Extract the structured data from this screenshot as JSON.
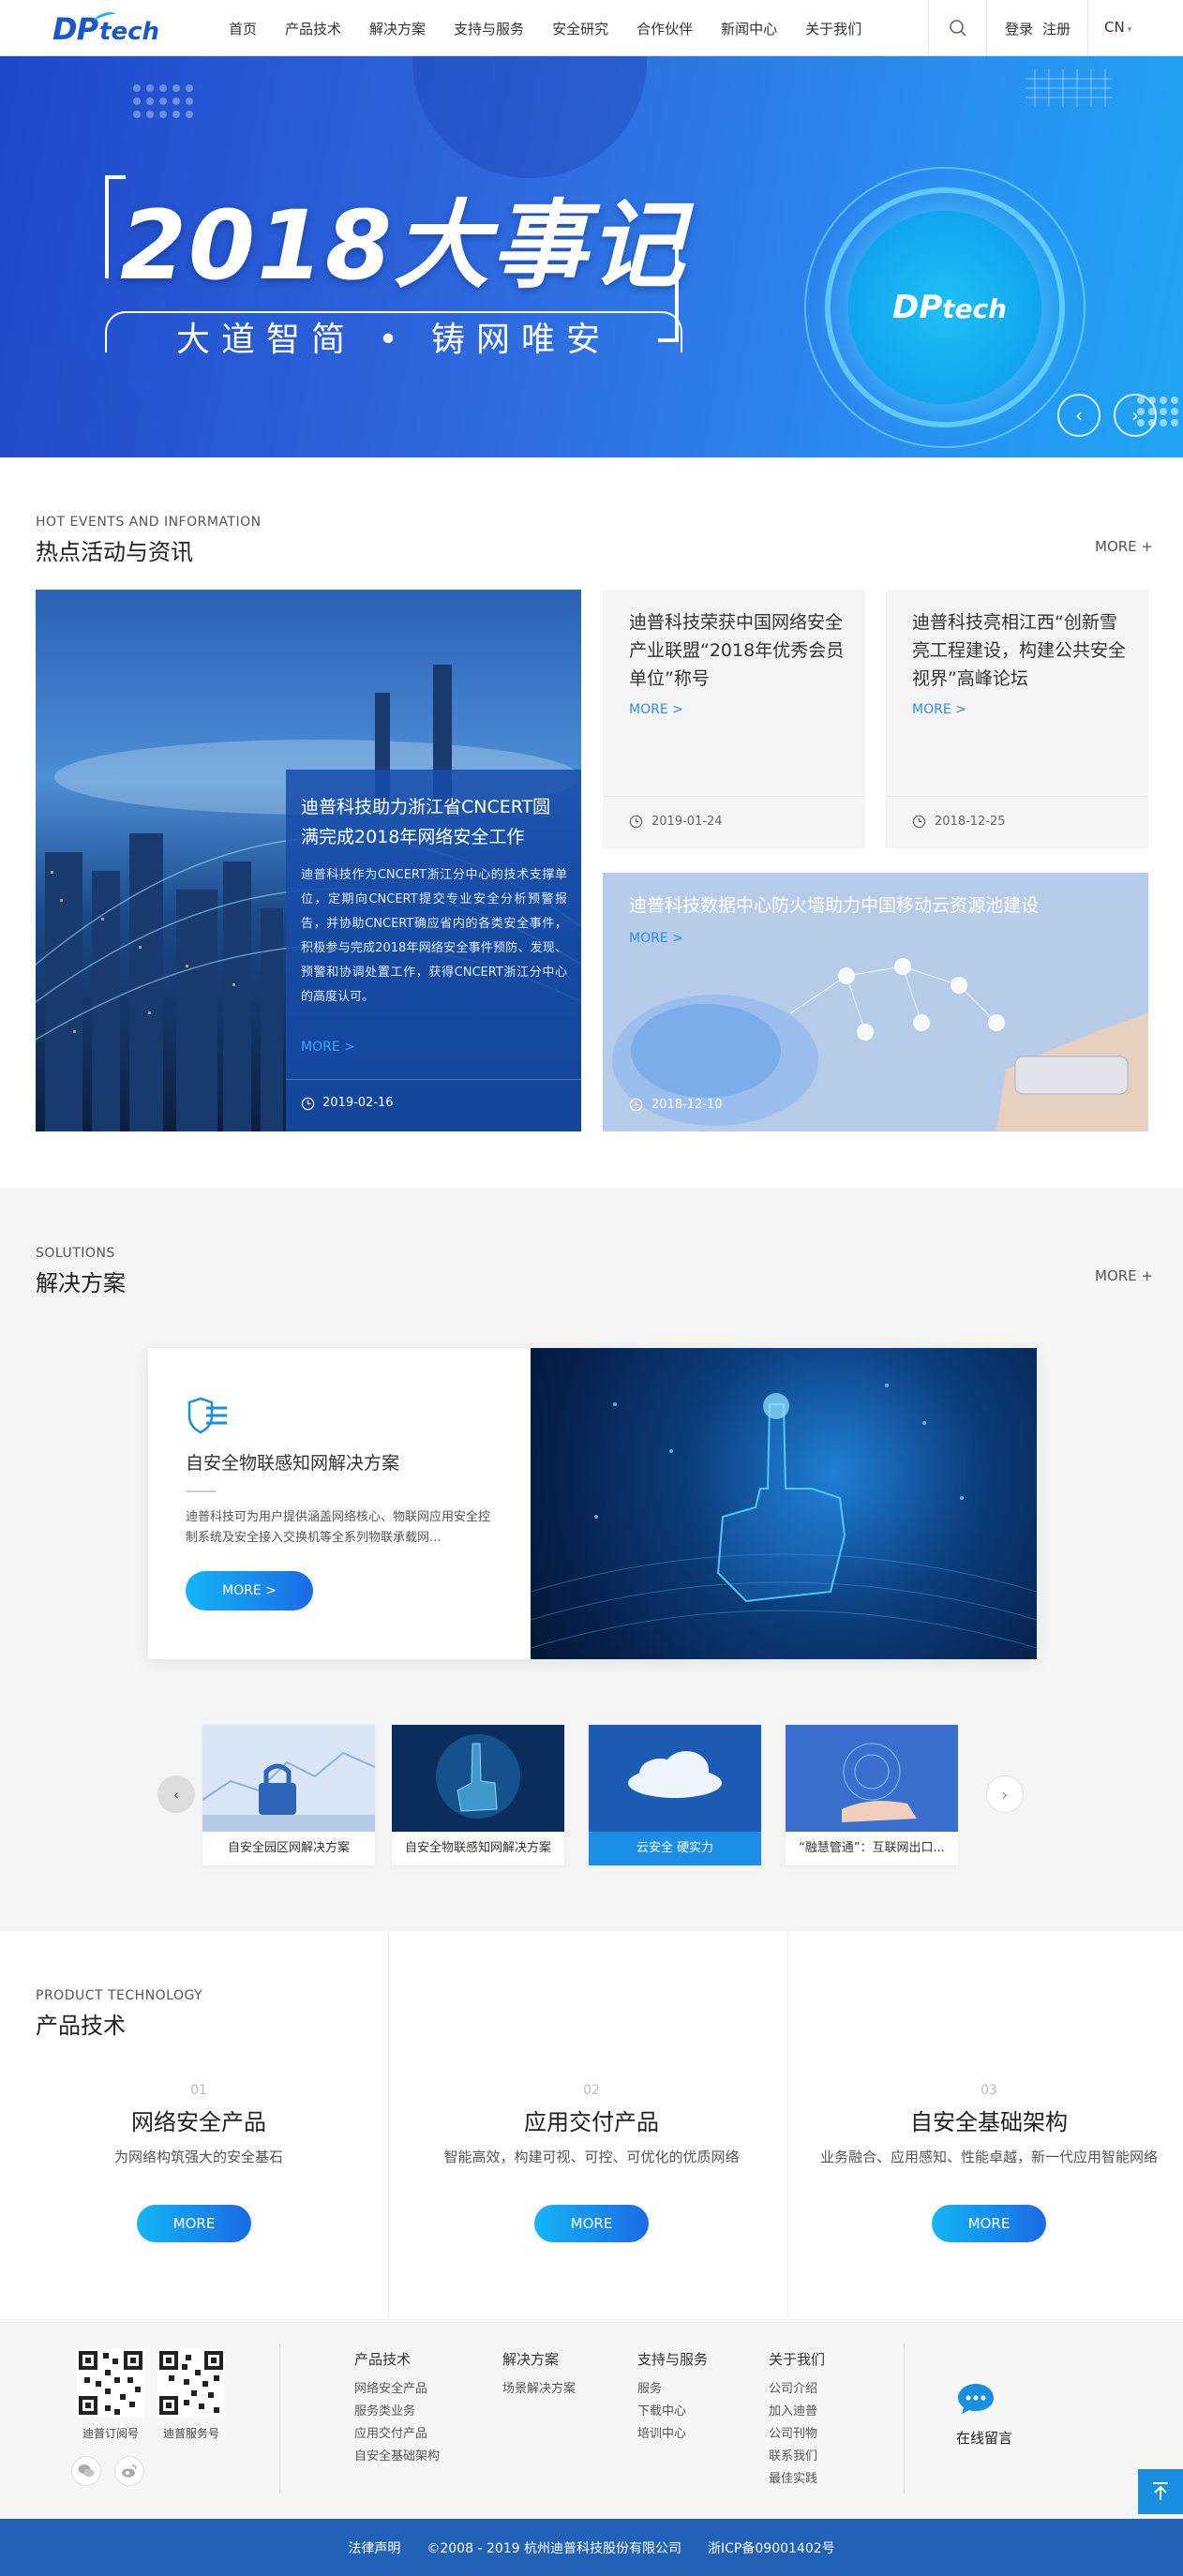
{
  "header": {
    "logo_main": "DP",
    "logo_sub": "tech",
    "nav": [
      "首页",
      "产品技术",
      "解决方案",
      "支持与服务",
      "安全研究",
      "合作伙伴",
      "新闻中心",
      "关于我们"
    ],
    "login": "登录",
    "register": "注册",
    "lang": "CN"
  },
  "banner": {
    "title": "2018大事记",
    "slogan": "大道智简 • 铸网唯安",
    "logo_main": "DP",
    "logo_sub": "tech",
    "prev": "‹",
    "next": "›"
  },
  "news": {
    "en": "HOT EVENTS AND INFORMATION",
    "cn": "热点活动与资讯",
    "more": "MORE +",
    "big": {
      "title": "迪普科技助力浙江省CNCERT圆满完成2018年网络安全工作",
      "desc": "迪普科技作为CNCERT浙江分中心的技术支撑单位，定期向CNCERT提交专业安全分析预警报告，并协助CNCERT确应省内的各类安全事件，积极参与完成2018年网络安全事件预防、发现、预警和协调处置工作，获得CNCERT浙江分中心的高度认可。",
      "more": "MORE >",
      "date": "2019-02-16"
    },
    "cards": [
      {
        "title": "迪普科技荣获中国网络安全产业联盟“2018年优秀会员单位”称号",
        "more": "MORE >",
        "date": "2019-01-24"
      },
      {
        "title": "迪普科技亮相江西“创新雪亮工程建设，构建公共安全视界”高峰论坛",
        "more": "MORE >",
        "date": "2018-12-25"
      }
    ],
    "wide": {
      "title": "迪普科技数据中心防火墙助力中国移动云资源池建设",
      "more": "MORE >",
      "date": "2018-12-10"
    }
  },
  "solutions": {
    "en": "SOLUTIONS",
    "cn": "解决方案",
    "more": "MORE +",
    "featured": {
      "title": "自安全物联感知网解决方案",
      "desc": "迪普科技可为用户提供涵盖网络核心、物联网应用安全控制系统及安全接入交换机等全系列物联承载网...",
      "btn": "MORE >"
    },
    "thumbs": [
      {
        "label": "自安全园区网解决方案",
        "active": false
      },
      {
        "label": "自安全物联感知网解决方案",
        "active": false
      },
      {
        "label": "云安全 硬实力",
        "active": true
      },
      {
        "label": "“融慧管通”：互联网出口...",
        "active": false
      }
    ]
  },
  "products": {
    "en": "PRODUCT TECHNOLOGY",
    "cn": "产品技术",
    "items": [
      {
        "num": "01",
        "title": "网络安全产品",
        "desc": "为网络构筑强大的安全基石",
        "btn": "MORE"
      },
      {
        "num": "02",
        "title": "应用交付产品",
        "desc": "智能高效，构建可视、可控、可优化的优质网络",
        "btn": "MORE"
      },
      {
        "num": "03",
        "title": "自安全基础架构",
        "desc": "业务融合、应用感知、性能卓越，新一代应用智能网络",
        "btn": "MORE"
      }
    ]
  },
  "footer": {
    "qr1_label": "迪普订阅号",
    "qr2_label": "迪普服务号",
    "columns": [
      {
        "title": "产品技术",
        "links": [
          "网络安全产品",
          "服务类业务",
          "应用交付产品",
          "自安全基础架构"
        ]
      },
      {
        "title": "解决方案",
        "links": [
          "场景解决方案"
        ]
      },
      {
        "title": "支持与服务",
        "links": [
          "服务",
          "下载中心",
          "培训中心"
        ]
      },
      {
        "title": "关于我们",
        "links": [
          "公司介绍",
          "加入迪普",
          "公司刊物",
          "联系我们",
          "最佳实践"
        ]
      }
    ],
    "message": "在线留言",
    "legal": "法律声明",
    "copyright": "©2008 - 2019 杭州迪普科技股份有限公司",
    "icp": "浙ICP备09001402号"
  }
}
